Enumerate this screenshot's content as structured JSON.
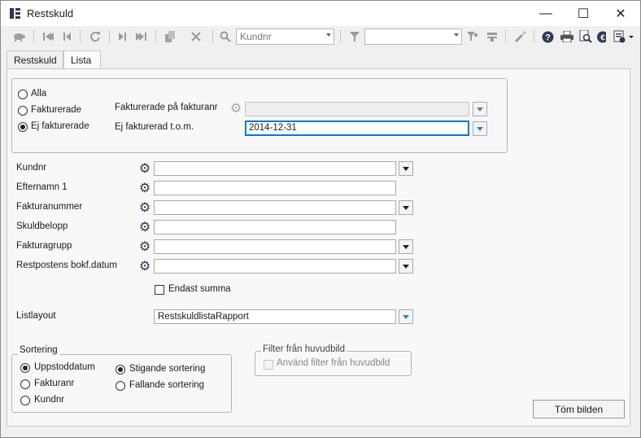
{
  "window": {
    "title": "Restskuld",
    "minimize_glyph": "—",
    "maximize_glyph": "☐",
    "close_glyph": "✕"
  },
  "toolbar": {
    "search_combo_value": "Kundnr",
    "filter_combo_value": "",
    "icons": [
      "turtle-icon",
      "first-record-icon",
      "previous-record-icon",
      "refresh-icon",
      "next-record-icon",
      "last-record-icon",
      "copy-icon",
      "delete-icon",
      "search-icon",
      "filter-icon",
      "filter-settings-icon",
      "remove-filter-icon",
      "edit-icon",
      "help-icon",
      "print-icon",
      "print-preview-icon",
      "info-icon",
      "document-menu-icon"
    ]
  },
  "tabs": [
    "Restskuld",
    "Lista"
  ],
  "active_tab": "Lista",
  "selection": {
    "options": [
      "Alla",
      "Fakturerade",
      "Ej fakturerade"
    ],
    "selected": "Ej fakturerade",
    "invoiced_on_label": "Fakturerade på fakturanr",
    "invoiced_on_value": "",
    "not_invoiced_label": "Ej fakturerad t.o.m.",
    "not_invoiced_value": "2014-12-31"
  },
  "fields": [
    {
      "label": "Kundnr",
      "value": "",
      "has_dropdown": true
    },
    {
      "label": "Efternamn 1",
      "value": "",
      "has_dropdown": false
    },
    {
      "label": "Fakturanummer",
      "value": "",
      "has_dropdown": true
    },
    {
      "label": "Skuldbelopp",
      "value": "",
      "has_dropdown": false
    },
    {
      "label": "Fakturagrupp",
      "value": "",
      "has_dropdown": true
    },
    {
      "label": "Restpostens bokf.datum",
      "value": "",
      "has_dropdown": true
    }
  ],
  "only_sum": {
    "label": "Endast summa",
    "checked": false
  },
  "list_layout": {
    "label": "Listlayout",
    "value": "RestskuldlistaRapport"
  },
  "sorting": {
    "legend": "Sortering",
    "by_options": [
      "Uppstoddatum",
      "Fakturanr",
      "Kundnr"
    ],
    "by_selected": "Uppstoddatum",
    "order_options": [
      "Stigande sortering",
      "Fallande sortering"
    ],
    "order_selected": "Stigande sortering"
  },
  "main_filter": {
    "legend": "Filter från huvudbild",
    "checkbox_label": "Använd filter från huvudbild",
    "checked": false,
    "enabled": false
  },
  "clear_button": "Töm bilden",
  "colors": {
    "accent": "#0078d7",
    "icon_dark": "#2d3b52",
    "dropdown_blue": "#2b86c5"
  }
}
